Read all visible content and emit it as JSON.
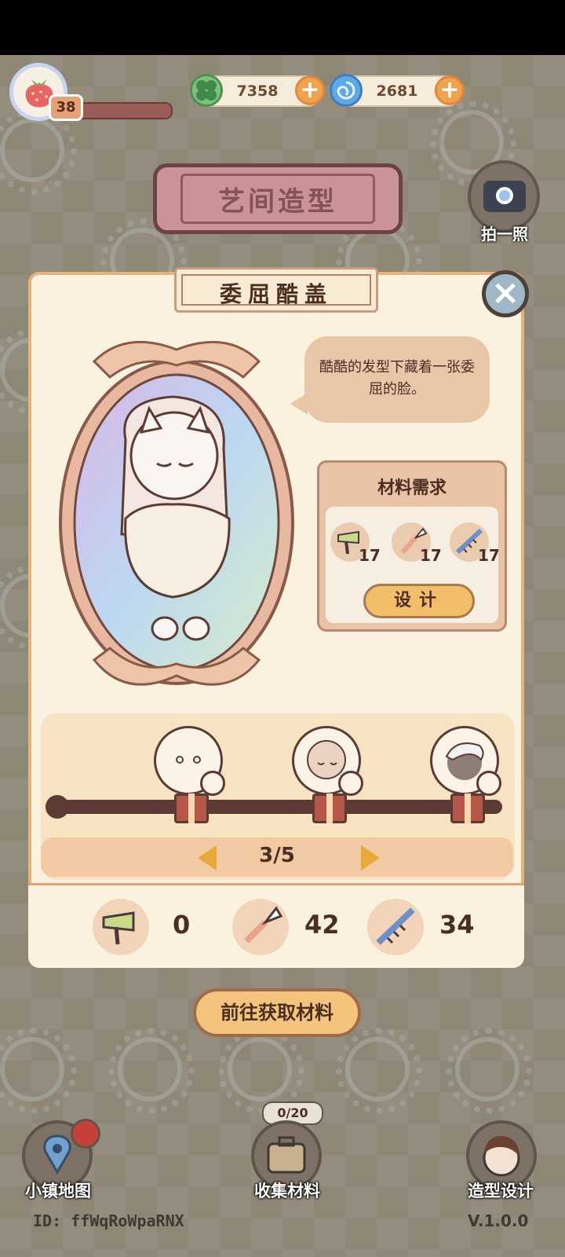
{
  "hud": {
    "level": "38",
    "clover_amount": "7358",
    "swirl_amount": "2681",
    "avatar_icon": "strawberry-icon"
  },
  "header": {
    "title": "艺间造型",
    "camera_label": "拍一照"
  },
  "panel": {
    "name": "委屈酷盖",
    "speech": "酷酷的发型下藏着一张委屈的脸。",
    "materials_title": "材料需求",
    "materials": [
      {
        "icon": "hair-dryer-icon",
        "count": "17"
      },
      {
        "icon": "makeup-brush-icon",
        "count": "17"
      },
      {
        "icon": "comb-icon",
        "count": "17"
      }
    ],
    "design_label": "设计",
    "page": "3/5",
    "owned": [
      {
        "icon": "hair-dryer-icon",
        "count": "0"
      },
      {
        "icon": "makeup-brush-icon",
        "count": "42"
      },
      {
        "icon": "comb-icon",
        "count": "34"
      }
    ]
  },
  "actions": {
    "get_materials": "前往获取材料"
  },
  "bottom_nav": {
    "map_label": "小镇地图",
    "collect_label": "收集材料",
    "collect_count": "0/20",
    "design_label": "造型设计"
  },
  "footer": {
    "id": "ID: ffWqRoWpaRNX",
    "version": "V.1.0.0"
  },
  "colors": {
    "accent": "#f2be6a",
    "panel": "#faf2df",
    "title_plaque": "#c99397"
  }
}
